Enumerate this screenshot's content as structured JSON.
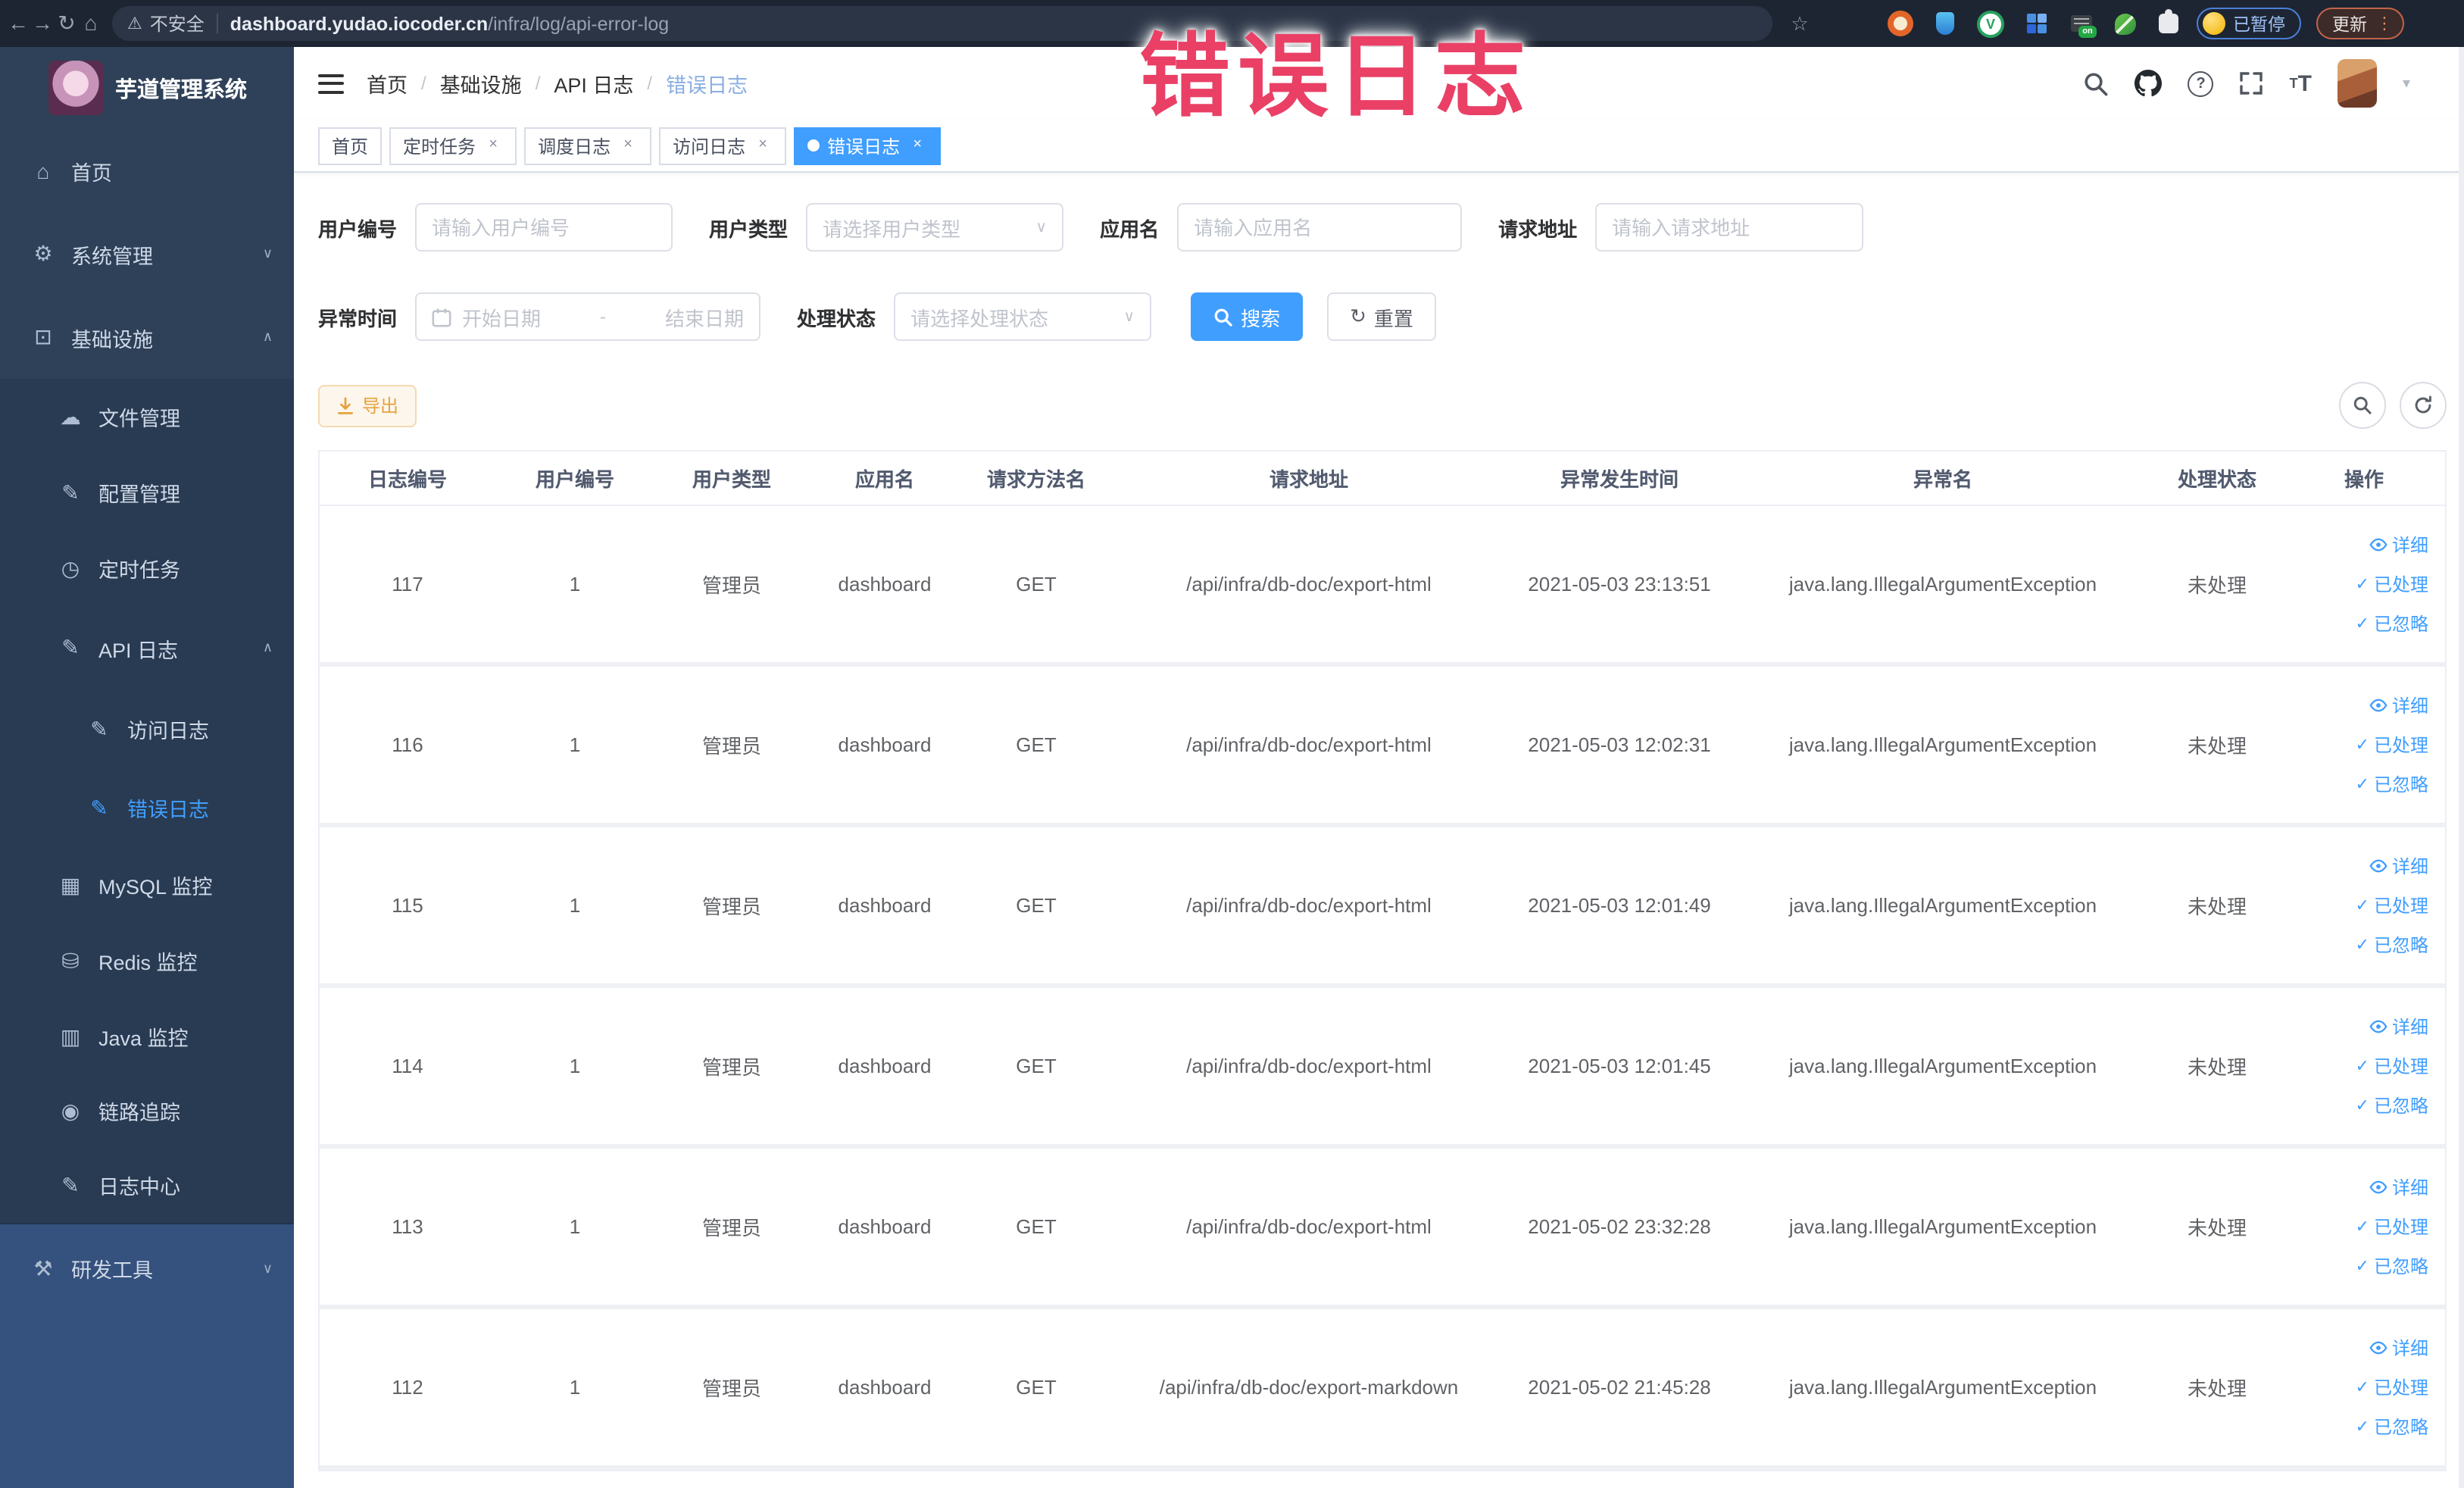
{
  "browser": {
    "security_label": "不安全",
    "url_host": "dashboard.yudao.iocoder.cn",
    "url_path": "/infra/log/api-error-log",
    "profile_status": "已暂停",
    "update_label": "更新",
    "icon_names": [
      "back",
      "forward",
      "reload",
      "home",
      "warning",
      "bookmark-star",
      "target-extension",
      "shield-extension",
      "green-check-extension",
      "grid-extension",
      "on-switch-extension",
      "leaf-extension",
      "puzzle-extension",
      "kebab-menu"
    ]
  },
  "watermark": "错误日志",
  "theme": {
    "accent": "#409eff",
    "warning": "#e6a23c",
    "watermark_pink": "#ea4066",
    "sidebar_bg": "#2e4158",
    "sidebar_sub_bg": "#293b52",
    "sidebar_bottom_bg": "#35517d",
    "chrome_bg": "#1d2533"
  },
  "sidebar": {
    "title": "芋道管理系统",
    "items": [
      {
        "label": "首页",
        "icon": "home-icon"
      },
      {
        "label": "系统管理",
        "icon": "gear-icon"
      },
      {
        "label": "基础设施",
        "icon": "monitor-icon"
      },
      {
        "label": "文件管理",
        "icon": "cloud-icon"
      },
      {
        "label": "配置管理",
        "icon": "edit-icon"
      },
      {
        "label": "定时任务",
        "icon": "clock-icon"
      },
      {
        "label": "API 日志",
        "icon": "log-edit-icon"
      },
      {
        "label": "访问日志",
        "icon": "log-edit-icon"
      },
      {
        "label": "错误日志",
        "icon": "log-edit-icon"
      },
      {
        "label": "MySQL 监控",
        "icon": "database-icon"
      },
      {
        "label": "Redis 监控",
        "icon": "disk-stack-icon"
      },
      {
        "label": "Java 监控",
        "icon": "screen-icon"
      },
      {
        "label": "链路追踪",
        "icon": "eye-icon"
      },
      {
        "label": "日志中心",
        "icon": "log-edit-icon"
      },
      {
        "label": "研发工具",
        "icon": "tools-icon"
      }
    ]
  },
  "header": {
    "breadcrumb": [
      "首页",
      "基础设施",
      "API 日志",
      "错误日志"
    ],
    "icon_names": [
      "search-icon",
      "github-icon",
      "help-icon",
      "fullscreen-icon",
      "font-size-icon",
      "avatar",
      "chevron-down-icon"
    ]
  },
  "tabs": [
    "首页",
    "定时任务",
    "调度日志",
    "访问日志",
    "错误日志"
  ],
  "filters": {
    "user_id": {
      "label": "用户编号",
      "placeholder": "请输入用户编号"
    },
    "user_type": {
      "label": "用户类型",
      "placeholder": "请选择用户类型"
    },
    "app_name": {
      "label": "应用名",
      "placeholder": "请输入应用名"
    },
    "request_url": {
      "label": "请求地址",
      "placeholder": "请输入请求地址"
    },
    "exception_time": {
      "label": "异常时间",
      "start_placeholder": "开始日期",
      "separator": "-",
      "end_placeholder": "结束日期"
    },
    "process_status": {
      "label": "处理状态",
      "placeholder": "请选择处理状态"
    },
    "search_label": "搜索",
    "reset_label": "重置"
  },
  "toolbar": {
    "export_label": "导出"
  },
  "table": {
    "columns": [
      "日志编号",
      "用户编号",
      "用户类型",
      "应用名",
      "请求方法名",
      "请求地址",
      "异常发生时间",
      "异常名",
      "处理状态",
      "操作"
    ],
    "actions": {
      "detail": "详细",
      "processed": "已处理",
      "ignored": "已忽略"
    },
    "rows": [
      {
        "log_id": "117",
        "user_id": "1",
        "user_type": "管理员",
        "app_name": "dashboard",
        "method": "GET",
        "url": "/api/infra/db-doc/export-html",
        "time": "2021-05-03 23:13:51",
        "exception": "java.lang.IllegalArgumentException",
        "status": "未处理"
      },
      {
        "log_id": "116",
        "user_id": "1",
        "user_type": "管理员",
        "app_name": "dashboard",
        "method": "GET",
        "url": "/api/infra/db-doc/export-html",
        "time": "2021-05-03 12:02:31",
        "exception": "java.lang.IllegalArgumentException",
        "status": "未处理"
      },
      {
        "log_id": "115",
        "user_id": "1",
        "user_type": "管理员",
        "app_name": "dashboard",
        "method": "GET",
        "url": "/api/infra/db-doc/export-html",
        "time": "2021-05-03 12:01:49",
        "exception": "java.lang.IllegalArgumentException",
        "status": "未处理"
      },
      {
        "log_id": "114",
        "user_id": "1",
        "user_type": "管理员",
        "app_name": "dashboard",
        "method": "GET",
        "url": "/api/infra/db-doc/export-html",
        "time": "2021-05-03 12:01:45",
        "exception": "java.lang.IllegalArgumentException",
        "status": "未处理"
      },
      {
        "log_id": "113",
        "user_id": "1",
        "user_type": "管理员",
        "app_name": "dashboard",
        "method": "GET",
        "url": "/api/infra/db-doc/export-html",
        "time": "2021-05-02 23:32:28",
        "exception": "java.lang.IllegalArgumentException",
        "status": "未处理"
      },
      {
        "log_id": "112",
        "user_id": "1",
        "user_type": "管理员",
        "app_name": "dashboard",
        "method": "GET",
        "url": "/api/infra/db-doc/export-markdown",
        "time": "2021-05-02 21:45:28",
        "exception": "java.lang.IllegalArgumentException",
        "status": "未处理"
      }
    ]
  }
}
